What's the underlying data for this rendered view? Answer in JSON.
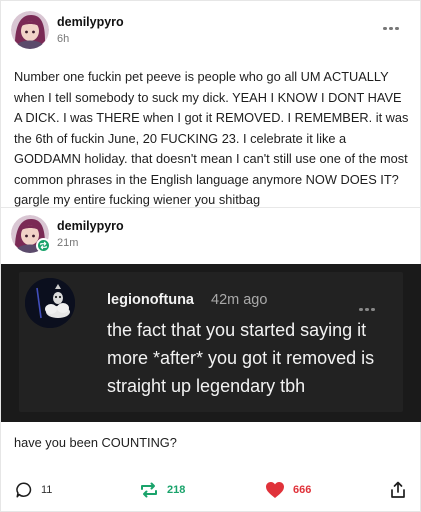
{
  "post": {
    "author": "demilypyro",
    "time": "6h",
    "body": "Number one fuckin pet peeve is people who go all UM ACTUALLY when I tell somebody to suck my dick. YEAH I KNOW I DONT HAVE A DICK. I was THERE when I got it REMOVED. I REMEMBER. it was the 6th of fuckin June, 20 FUCKING 23. I celebrate it like a GODDAMN holiday. that doesn't mean I can't still use one of the most common phrases in the English language anymore NOW DOES IT? gargle my entire fucking wiener you shitbag"
  },
  "reblog": {
    "author": "demilypyro",
    "time": "21m"
  },
  "quoted": {
    "author": "legionoftuna",
    "time": "42m ago",
    "text": "the fact that you started saying it more *after* you got it removed is straight up legendary tbh"
  },
  "reply": "have you been COUNTING?",
  "footer": {
    "comments": "11",
    "reblogs": "218",
    "likes": "666"
  },
  "colors": {
    "reblog_green": "#1aa36b",
    "like_red": "#e0323a",
    "quote_bg": "#222222"
  },
  "icons": [
    "more-icon",
    "reblog-badge-icon",
    "comment-icon",
    "reblog-icon",
    "heart-icon",
    "share-icon"
  ]
}
